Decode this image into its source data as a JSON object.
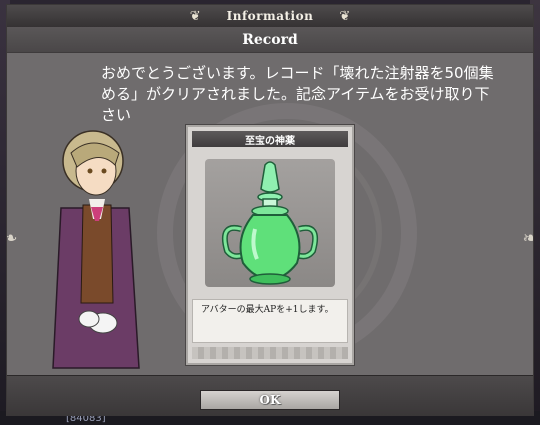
{
  "window": {
    "title": "Information",
    "subtitle": "Record",
    "title_ornament_icon": "fleur-ornament-icon"
  },
  "message": "おめでとうございます。レコード「壊れた注射器を50個集める」がクリアされました。記念アイテムをお受け取り下さい",
  "item": {
    "name": "至宝の神薬",
    "image_icon": "green-potion-bottle-icon",
    "description": "アバターの最大APを+1します。"
  },
  "buttons": {
    "ok_label": "OK"
  },
  "background": {
    "bottom_text": "[84083]"
  },
  "colors": {
    "panel": "#6f6c6d",
    "potion": "#5fe07a",
    "title_bar": "#3f3c3d"
  }
}
